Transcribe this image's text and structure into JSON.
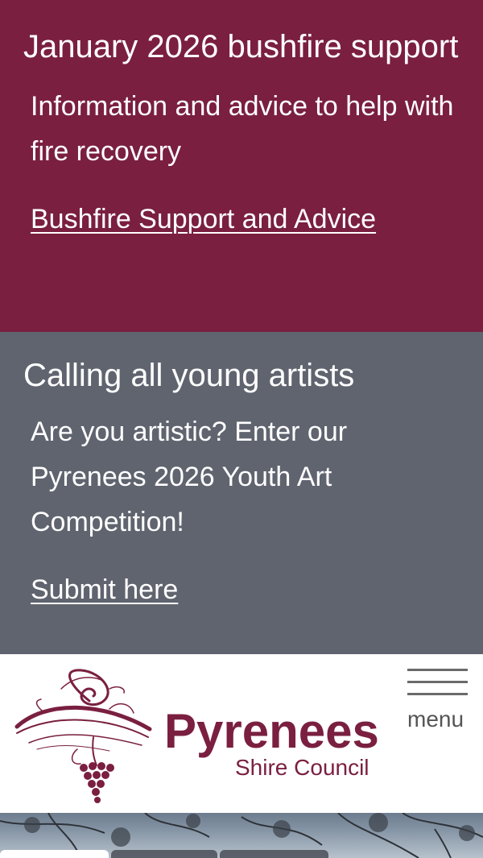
{
  "alerts": [
    {
      "title": "January 2026 bushfire support",
      "text": "Information and advice to help with fire recovery",
      "link": "Bushfire Support and Advice"
    },
    {
      "title": "Calling all young artists",
      "text": "Are you artistic? Enter our Pyrenees 2026 Youth Art Competition!",
      "link": "Submit here"
    }
  ],
  "header": {
    "logo_word": "Pyrenees",
    "logo_sub": "Shire Council",
    "menu_label": "menu"
  },
  "colors": {
    "fire_alert_bg": "#7a1f40",
    "art_alert_bg": "#60646f",
    "brand": "#7a1f40"
  }
}
